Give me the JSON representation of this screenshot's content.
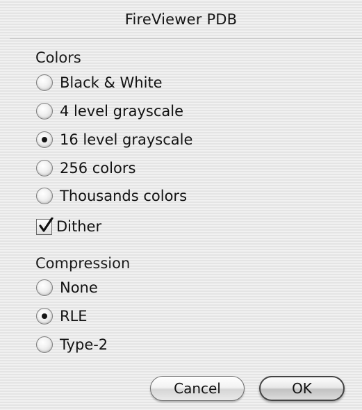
{
  "window": {
    "title": "FireViewer PDB"
  },
  "colors": {
    "label": "Colors",
    "options": [
      {
        "label": "Black & White",
        "selected": false
      },
      {
        "label": "4 level grayscale",
        "selected": false
      },
      {
        "label": "16 level grayscale",
        "selected": true
      },
      {
        "label": "256 colors",
        "selected": false
      },
      {
        "label": "Thousands colors",
        "selected": false
      }
    ],
    "dither": {
      "label": "Dither",
      "checked": true
    }
  },
  "compression": {
    "label": "Compression",
    "options": [
      {
        "label": "None",
        "selected": false
      },
      {
        "label": "RLE",
        "selected": true
      },
      {
        "label": "Type-2",
        "selected": false
      }
    ]
  },
  "buttons": {
    "cancel_label": "Cancel",
    "ok_label": "OK"
  }
}
